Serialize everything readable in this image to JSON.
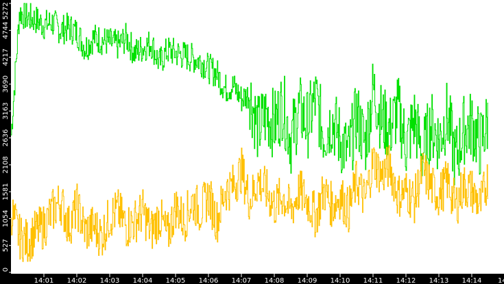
{
  "chart_data": {
    "type": "line",
    "title": "",
    "xlabel": "",
    "ylabel": "",
    "ylim": [
      0,
      5272
    ],
    "yticks": [
      "0",
      "527",
      "1054",
      "1581",
      "2108",
      "2636",
      "3163",
      "3690",
      "4217",
      "4744",
      "5272"
    ],
    "ytick_values": [
      0,
      527,
      1054,
      1581,
      2108,
      2636,
      3163,
      3690,
      4217,
      4744,
      5272
    ],
    "xticks": [
      "14:01",
      "14:02",
      "14:03",
      "14:04",
      "14:05",
      "14:06",
      "14:07",
      "14:08",
      "14:09",
      "14:10",
      "14:11",
      "14:12",
      "14:13",
      "14:14",
      "14"
    ],
    "x_start": "14:00:00",
    "x_step_seconds": 15,
    "grid": false,
    "series": [
      {
        "name": "green",
        "color": "#00e000",
        "values": [
          2700,
          5100,
          5000,
          4950,
          4850,
          4900,
          4750,
          4800,
          4700,
          4400,
          4600,
          4550,
          4500,
          4450,
          4600,
          4300,
          4400,
          4500,
          4100,
          4350,
          4300,
          4250,
          4200,
          4150,
          4000,
          3900,
          3600,
          3650,
          3400,
          3500,
          2800,
          3100,
          2900,
          3300,
          2600,
          3200,
          2900,
          3400,
          2700,
          3000,
          2600,
          2300,
          3100,
          2500,
          3600,
          3000,
          2800,
          3200,
          2500,
          3000,
          2300,
          2900,
          2600,
          3100,
          2200,
          2800,
          2900,
          2500,
          3000
        ]
      },
      {
        "name": "orange",
        "color": "#ffc000",
        "values": [
          1200,
          700,
          600,
          800,
          900,
          1200,
          1400,
          900,
          1300,
          800,
          900,
          700,
          1100,
          1200,
          900,
          1000,
          1200,
          800,
          1100,
          700,
          1300,
          1000,
          1400,
          1200,
          1500,
          1000,
          1600,
          1700,
          2000,
          1400,
          1800,
          1600,
          1300,
          1500,
          1200,
          1600,
          1400,
          1100,
          1600,
          1300,
          1500,
          1200,
          1800,
          1400,
          2200,
          1900,
          2100,
          1500,
          1600,
          1400,
          2000,
          1700,
          1500,
          1800,
          1300,
          1700,
          1600,
          1300,
          1900
        ]
      }
    ]
  }
}
